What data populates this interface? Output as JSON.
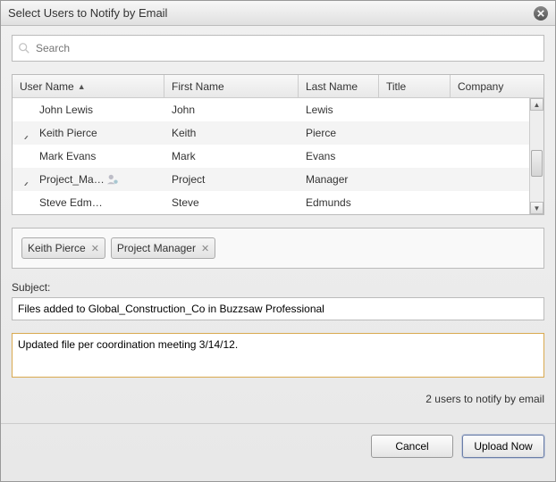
{
  "dialog": {
    "title": "Select Users to Notify by Email"
  },
  "search": {
    "placeholder": "Search"
  },
  "table": {
    "columns": [
      "User Name",
      "First Name",
      "Last Name",
      "Title",
      "Company"
    ],
    "sort_column": 0,
    "rows": [
      {
        "selected": false,
        "user_name": "John Lewis",
        "first_name": "John",
        "last_name": "Lewis",
        "title": "",
        "company": "",
        "has_icon": false
      },
      {
        "selected": true,
        "user_name": "Keith Pierce",
        "first_name": "Keith",
        "last_name": "Pierce",
        "title": "",
        "company": "",
        "has_icon": false
      },
      {
        "selected": false,
        "user_name": "Mark Evans",
        "first_name": "Mark",
        "last_name": "Evans",
        "title": "",
        "company": "",
        "has_icon": false
      },
      {
        "selected": true,
        "user_name": "Project_Ma…",
        "first_name": "Project",
        "last_name": "Manager",
        "title": "",
        "company": "",
        "has_icon": true
      },
      {
        "selected": false,
        "user_name": "Steve Edm…",
        "first_name": "Steve",
        "last_name": "Edmunds",
        "title": "",
        "company": "",
        "has_icon": false
      }
    ]
  },
  "chips": [
    "Keith Pierce",
    "Project Manager"
  ],
  "subject": {
    "label": "Subject:",
    "value": "Files added to Global_Construction_Co in Buzzsaw Professional"
  },
  "message": {
    "value": "Updated file per coordination meeting 3/14/12."
  },
  "status": "2 users to notify by email",
  "buttons": {
    "cancel": "Cancel",
    "upload": "Upload Now"
  }
}
